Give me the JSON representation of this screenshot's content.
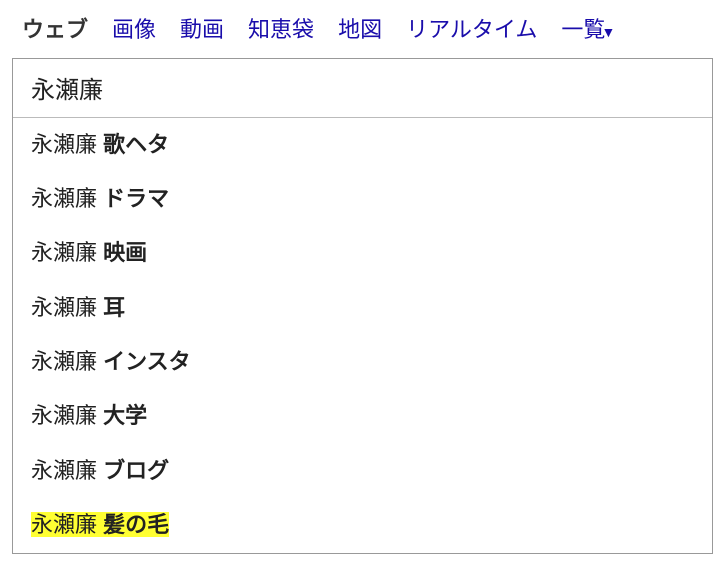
{
  "tabs": {
    "web": "ウェブ",
    "image": "画像",
    "video": "動画",
    "chiebukuro": "知恵袋",
    "map": "地図",
    "realtime": "リアルタイム",
    "list": "一覧"
  },
  "search": {
    "value": "永瀬廉"
  },
  "suggestions": [
    {
      "base": "永瀬廉 ",
      "extra": "歌ヘタ",
      "highlighted": false
    },
    {
      "base": "永瀬廉 ",
      "extra": "ドラマ",
      "highlighted": false
    },
    {
      "base": "永瀬廉 ",
      "extra": "映画",
      "highlighted": false
    },
    {
      "base": "永瀬廉 ",
      "extra": "耳",
      "highlighted": false
    },
    {
      "base": "永瀬廉 ",
      "extra": "インスタ",
      "highlighted": false
    },
    {
      "base": "永瀬廉 ",
      "extra": "大学",
      "highlighted": false
    },
    {
      "base": "永瀬廉 ",
      "extra": "ブログ",
      "highlighted": false
    },
    {
      "base": "永瀬廉 ",
      "extra": "髪の毛",
      "highlighted": true
    }
  ]
}
